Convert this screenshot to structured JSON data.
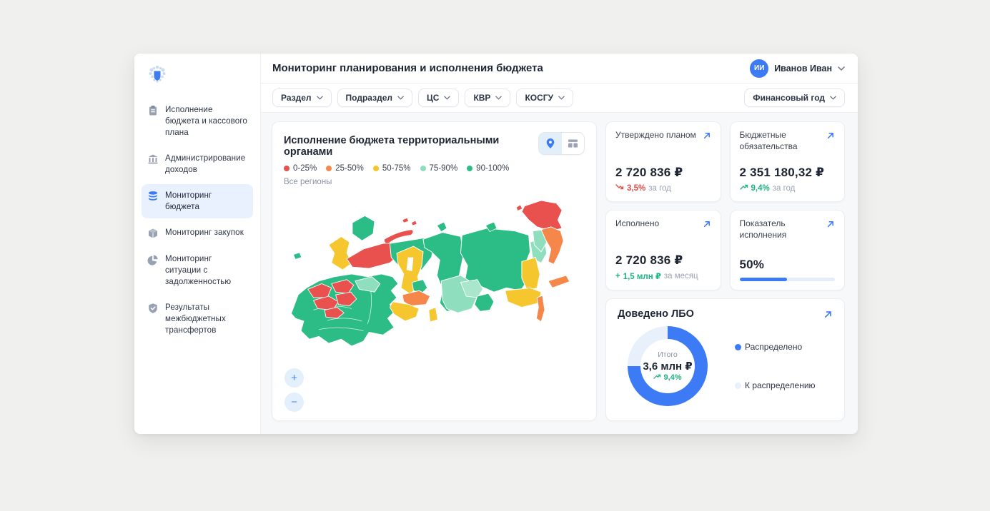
{
  "header": {
    "title": "Мониторинг планирования и исполнения бюджета",
    "user": {
      "initials": "ИИ",
      "name": "Иванов Иван"
    }
  },
  "sidebar": {
    "items": [
      {
        "label": "Исполнение бюджета и кассового плана",
        "icon": "clipboard",
        "active": false
      },
      {
        "label": "Администрирование доходов",
        "icon": "bank",
        "active": false
      },
      {
        "label": "Мониторинг бюджета",
        "icon": "database",
        "active": true
      },
      {
        "label": "Мониторинг закупок",
        "icon": "cube",
        "active": false
      },
      {
        "label": "Мониторинг ситуации с задолженностью",
        "icon": "pie-chart",
        "active": false
      },
      {
        "label": "Результаты межбюджетных трансфертов",
        "icon": "shield-check",
        "active": false
      }
    ]
  },
  "filters": {
    "items": [
      {
        "label": "Раздел"
      },
      {
        "label": "Подраздел"
      },
      {
        "label": "ЦС"
      },
      {
        "label": "КВР"
      },
      {
        "label": "КОСГУ"
      }
    ],
    "year_filter": "Финансовый год"
  },
  "map_card": {
    "title": "Исполнение бюджета территориальными органами",
    "subtitle": "Все регионы",
    "legend": [
      {
        "label": "0-25%",
        "color": "#e8514d"
      },
      {
        "label": "25-50%",
        "color": "#f5874a"
      },
      {
        "label": "50-75%",
        "color": "#f6c62e"
      },
      {
        "label": "75-90%",
        "color": "#8fdfbe"
      },
      {
        "label": "90-100%",
        "color": "#2bbd85"
      }
    ],
    "zoom_in": "+",
    "zoom_out": "−"
  },
  "kpis": [
    {
      "label": "Утверждено планом",
      "value": "2 720 836 ₽",
      "delta": "3,5%",
      "delta_dir": "down",
      "suffix": "за год"
    },
    {
      "label": "Бюджетные обязательства",
      "value": "2 351 180,32 ₽",
      "delta": "9,4%",
      "delta_dir": "up",
      "suffix": "за год"
    },
    {
      "label": "Исполнено",
      "value": "2 720 836 ₽",
      "delta_prefix": "+",
      "delta": "1,5 млн ₽",
      "delta_dir": "up",
      "suffix": "за месяц"
    },
    {
      "label": "Показатель исполнения",
      "value": "50%",
      "progress": 50
    }
  ],
  "lbo_card": {
    "title": "Доведено ЛБО",
    "center_label": "Итого",
    "center_value": "3,6 млн ₽",
    "center_delta": "9,4%",
    "distributed_pct": 75,
    "legend": [
      {
        "label": "Распределено",
        "color": "#3d7af5"
      },
      {
        "label": "К распределению",
        "color": "#e7f0fb"
      }
    ]
  },
  "colors": {
    "accent": "#3d7af5",
    "positive": "#1db47e",
    "negative": "#e24a45",
    "active_nav_bg": "#e8f1fd"
  }
}
